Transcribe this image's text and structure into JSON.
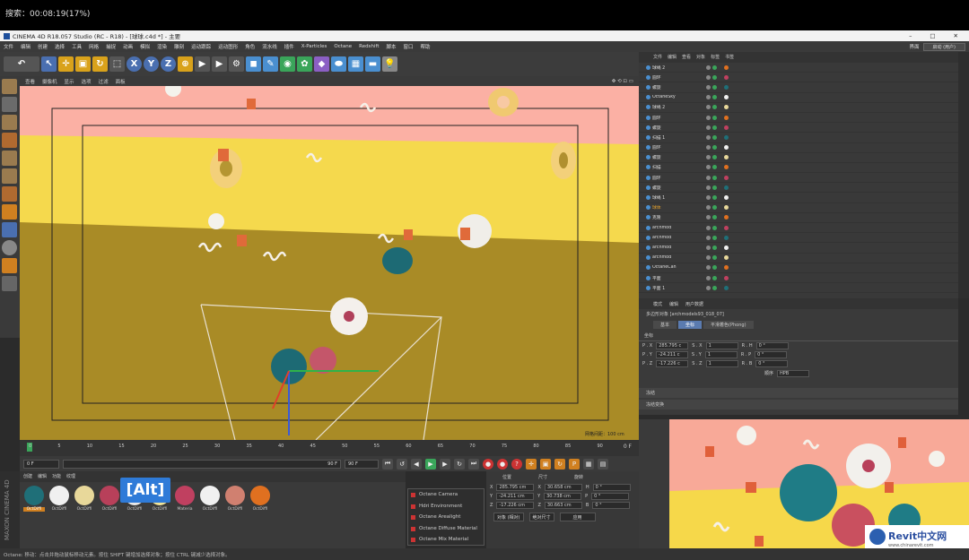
{
  "top_overlay": {
    "text": "搜索：00:08:19(17%)"
  },
  "window": {
    "title": "CINEMA 4D R18.057 Studio (RC - R18) - [球球.c4d *] - 主要",
    "min": "–",
    "max": "□",
    "close": "✕"
  },
  "menu": [
    "文件",
    "编辑",
    "创建",
    "选择",
    "工具",
    "网格",
    "捕捉",
    "动画",
    "模拟",
    "渲染",
    "雕刻",
    "运动跟踪",
    "运动图形",
    "角色",
    "流水线",
    "插件",
    "X-Particles",
    "Octane",
    "Redshift",
    "脚本",
    "窗口",
    "帮助"
  ],
  "layout": {
    "label": "界面",
    "value": "启动 (用户)"
  },
  "viewport": {
    "menu": [
      "查看",
      "摄像机",
      "显示",
      "选项",
      "过滤",
      "面板"
    ],
    "grid_text": "网格间距：100 cm"
  },
  "timeline": {
    "ticks": [
      "0",
      "5",
      "10",
      "15",
      "20",
      "25",
      "30",
      "35",
      "40",
      "45",
      "50",
      "55",
      "60",
      "65",
      "70",
      "75",
      "80",
      "85",
      "90"
    ],
    "end": "0 F"
  },
  "transport": {
    "start": "0 F",
    "cur": "0 F",
    "end": "90 F",
    "end2": "90 F"
  },
  "materials": {
    "tabs": [
      "创建",
      "编辑",
      "功能",
      "纹理"
    ],
    "items": [
      {
        "name": "OctDiffi",
        "color": "#1f6f78"
      },
      {
        "name": "OctDiffi",
        "color": "#f0f0f0"
      },
      {
        "name": "OctDiffi",
        "color": "#e8d89a"
      },
      {
        "name": "OctDiffi",
        "color": "#b8405a"
      },
      {
        "name": "OctDiffi",
        "color": "#e9e9e9"
      },
      {
        "name": "OctDiffi",
        "color": "#f0e39a"
      },
      {
        "name": "Materia",
        "color": "#c04060"
      },
      {
        "name": "OctDiffi",
        "color": "#f0f0f0"
      },
      {
        "name": "OctDiffi",
        "color": "#d08070"
      },
      {
        "name": "OctDiffi",
        "color": "#e07020"
      }
    ]
  },
  "alt_badge": "[Alt]",
  "octane_menu": [
    "Octane Camera",
    "Hdri Environment",
    "Octane Arealight",
    "Octane Diffuse Material",
    "Octane Mix Material"
  ],
  "coords": {
    "headers": [
      "位置",
      "尺寸",
      "旋转"
    ],
    "rows": [
      [
        "X",
        "285.795 cm",
        "X",
        "30.658 cm",
        "H",
        "0 °"
      ],
      [
        "Y",
        "-24.211 cm",
        "Y",
        "30.738 cm",
        "P",
        "0 °"
      ],
      [
        "Z",
        "-17.226 cm",
        "Z",
        "30.663 cm",
        "B",
        "0 °"
      ]
    ],
    "mode": "对象 (相对)",
    "size_mode": "绝对尺寸",
    "apply": "应用"
  },
  "status": "Octane:    移动：点击并拖动鼠标移动元素。按住 SHIFT 键增加选择对象；按住 CTRL 键减少选择对象。",
  "object_manager": {
    "menu": [
      "文件",
      "编辑",
      "查看",
      "对象",
      "标签",
      "书签"
    ],
    "rows": [
      "球绳 2",
      "圆环",
      "螺旋",
      "OctaneSky",
      "球绳 2",
      "圆环",
      "螺旋",
      "扫描 1",
      "圆环",
      "螺旋",
      "扫描",
      "圆环",
      "螺旋",
      "球绳 1",
      "球体",
      "克隆",
      "archmod",
      "archmod",
      "archmod",
      "archmod",
      "OctaneCan",
      "平面",
      "平面 1"
    ]
  },
  "attributes": {
    "menu": [
      "模式",
      "编辑",
      "用户数据"
    ],
    "title": "多边形对象 [archmodels93_018_07]",
    "tabs": [
      "基本",
      "坐标",
      "平滑着色(Phong)"
    ],
    "section": "坐标",
    "rows": [
      [
        "P . X",
        "285.795 c",
        "S . X",
        "1",
        "R . H",
        "0 °"
      ],
      [
        "P . Y",
        "-24.211 c",
        "S . Y",
        "1",
        "R . P",
        "0 °"
      ],
      [
        "P . Z",
        "-17.226 c",
        "S . Z",
        "1",
        "R . B",
        "0 °"
      ]
    ],
    "order_label": "顺序",
    "order": "HPB",
    "collapse1": "冻结",
    "collapse2": "冻结变换"
  },
  "watermark": {
    "brand": "Revit中文网",
    "url": "www.chinarevit.com"
  },
  "logo": "MAXON CINEMA 4D"
}
